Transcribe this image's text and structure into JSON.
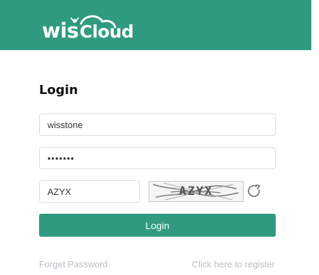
{
  "header": {
    "logo_text": "wiscloud",
    "background": "#2f9a7f"
  },
  "login": {
    "title": "Login",
    "username_value": "wisstone",
    "password_value": "•••••••",
    "captcha_value": "AZYX",
    "captcha_image_text": "AZYX",
    "refresh_icon": "refresh-icon",
    "submit_label": "Login",
    "forgot_label": "Forget Password",
    "register_label": "Click here to register"
  }
}
